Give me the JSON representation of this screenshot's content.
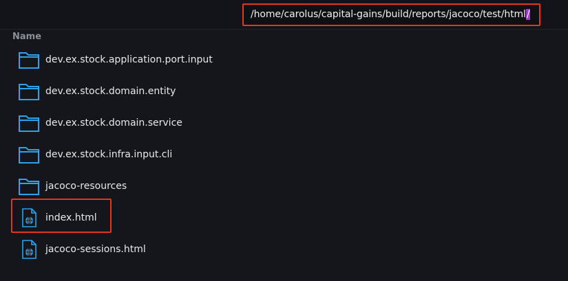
{
  "location_bar": {
    "path": "/home/carolus/capital-gains/build/reports/jacoco/test/html",
    "cursor_char": "/"
  },
  "columns": {
    "name": "Name"
  },
  "items": [
    {
      "label": "dev.ex.stock.application.port.input",
      "icon": "folder-icon"
    },
    {
      "label": "dev.ex.stock.domain.entity",
      "icon": "folder-icon"
    },
    {
      "label": "dev.ex.stock.domain.service",
      "icon": "folder-icon"
    },
    {
      "label": "dev.ex.stock.infra.input.cli",
      "icon": "folder-icon"
    },
    {
      "label": "jacoco-resources",
      "icon": "folder-icon"
    },
    {
      "label": "index.html",
      "icon": "html-file-icon"
    },
    {
      "label": "jacoco-sessions.html",
      "icon": "html-file-icon"
    }
  ],
  "colors": {
    "background": "#14161b",
    "highlight_border": "#e2381f",
    "folder_blue": "#2aa4ea",
    "cursor_purple": "#a43bcf"
  }
}
